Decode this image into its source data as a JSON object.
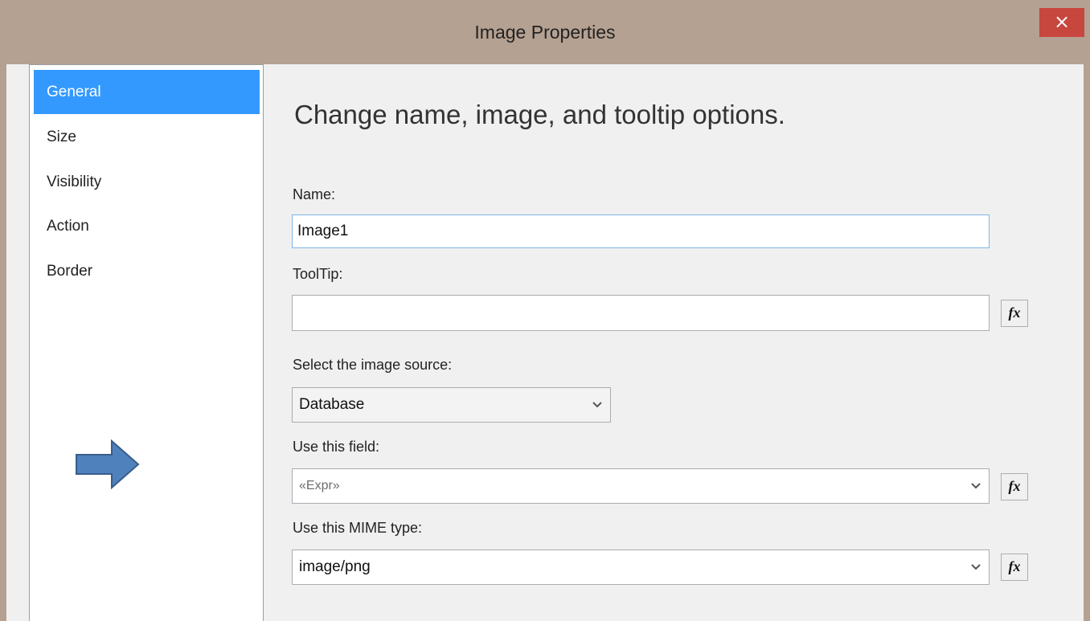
{
  "window": {
    "title": "Image Properties",
    "close_glyph": "×"
  },
  "nav": {
    "items": [
      {
        "label": "General",
        "selected": true
      },
      {
        "label": "Size",
        "selected": false
      },
      {
        "label": "Visibility",
        "selected": false
      },
      {
        "label": "Action",
        "selected": false
      },
      {
        "label": "Border",
        "selected": false
      }
    ]
  },
  "main": {
    "heading": "Change name, image, and tooltip options.",
    "name": {
      "label": "Name:",
      "value": "Image1"
    },
    "tooltip": {
      "label": "ToolTip:",
      "value": ""
    },
    "image_source": {
      "label": "Select the image source:",
      "selected": "Database"
    },
    "field": {
      "label": "Use this field:",
      "value": "«Expr»"
    },
    "mime": {
      "label": "Use this MIME type:",
      "value": "image/png"
    },
    "fx_label": "fx"
  },
  "colors": {
    "accent": "#3399ff",
    "titlebar": "#b5a191",
    "close": "#c7463d",
    "arrow": "#4f81bd"
  },
  "icons": {
    "close": "close-icon",
    "chevron": "chevron-down-icon",
    "arrow": "right-arrow-icon",
    "expression": "fx-icon"
  }
}
